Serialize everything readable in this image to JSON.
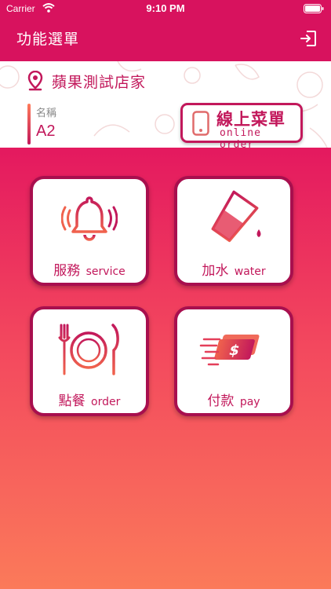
{
  "status_bar": {
    "carrier": "Carrier",
    "time": "9:10 PM"
  },
  "nav": {
    "title": "功能選單"
  },
  "store": {
    "name": "蘋果測試店家",
    "table_label": "名稱",
    "table_value": "A2"
  },
  "online_order": {
    "title_zh": "線上菜單",
    "title_en": "online order"
  },
  "tiles": [
    {
      "zh": "服務",
      "en": "service"
    },
    {
      "zh": "加水",
      "en": "water"
    },
    {
      "zh": "點餐",
      "en": "order"
    },
    {
      "zh": "付款",
      "en": "pay"
    }
  ],
  "colors": {
    "brand": "#d8125e",
    "accent": "#c2185b",
    "gradient_end": "#fb7a5a"
  },
  "icons": [
    "wifi-icon",
    "battery-icon",
    "logout-icon",
    "location-pin-icon",
    "phone-icon",
    "bell-icon",
    "water-glass-icon",
    "plate-cutlery-icon",
    "money-icon"
  ]
}
